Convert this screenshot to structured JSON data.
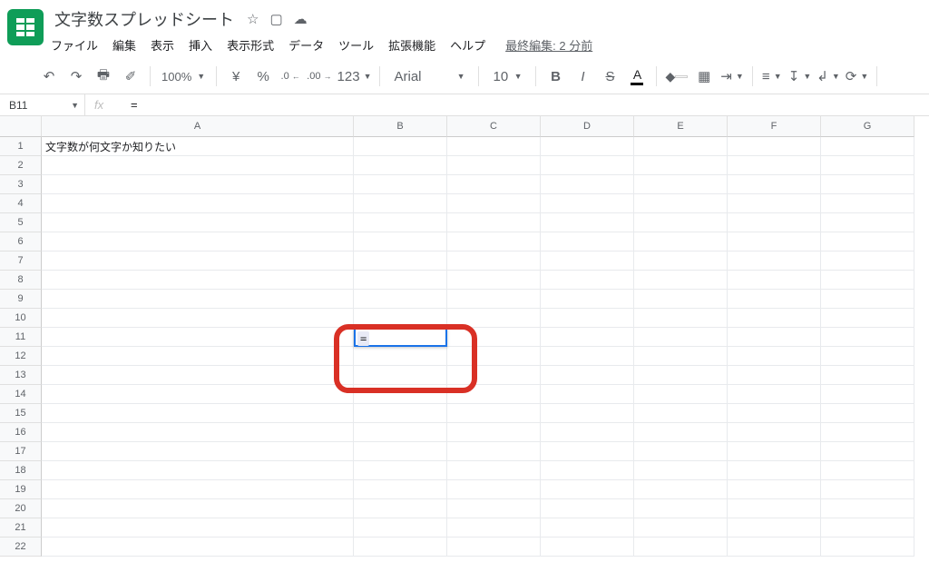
{
  "header": {
    "title": "文字数スプレッドシート"
  },
  "menubar": {
    "file": "ファイル",
    "edit": "編集",
    "view": "表示",
    "insert": "挿入",
    "format": "表示形式",
    "data": "データ",
    "tools": "ツール",
    "extensions": "拡張機能",
    "help": "ヘルプ",
    "last_edit": "最終編集: 2 分前"
  },
  "toolbar": {
    "zoom": "100%",
    "currency": "¥",
    "percent": "%",
    "dec_dec": ".0",
    "dec_inc": ".00",
    "num_fmt": "123",
    "font": "Arial",
    "size": "10",
    "bold": "B",
    "italic": "I",
    "strike": "S",
    "text_a": "A"
  },
  "formula": {
    "name_box": "B11",
    "fx_label": "fx",
    "value": "="
  },
  "grid": {
    "columns": [
      "A",
      "B",
      "C",
      "D",
      "E",
      "F",
      "G"
    ],
    "rows": [
      1,
      2,
      3,
      4,
      5,
      6,
      7,
      8,
      9,
      10,
      11,
      12,
      13,
      14,
      15,
      16,
      17,
      18,
      19,
      20,
      21,
      22
    ],
    "a1": "文字数が何文字か知りたい",
    "active_cell_value": "="
  }
}
